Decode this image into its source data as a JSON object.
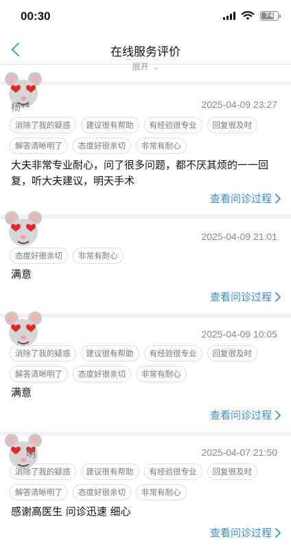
{
  "status_bar": {
    "time": "00:30",
    "battery": "74"
  },
  "nav": {
    "title": "在线服务评价",
    "expand_label": "展开"
  },
  "reviews": [
    {
      "username": "杨**",
      "date": "2025-04-09 23:27",
      "tags": [
        "消除了我的疑惑",
        "建议很有帮助",
        "有经验很专业",
        "回复很及时",
        "解答清晰明了",
        "态度好很亲切",
        "非常有耐心"
      ],
      "text": "大夫非常专业耐心，问了很多问题，都不厌其烦的一一回复，听大夫建议，明天手术",
      "link": "查看问诊过程"
    },
    {
      "username": "",
      "date": "2025-04-09 21:01",
      "tags": [
        "态度好很亲切",
        "非常有耐心"
      ],
      "text": "满意",
      "link": "查看问诊过程"
    },
    {
      "username": "",
      "date": "2025-04-09 10:05",
      "tags": [
        "消除了我的疑惑",
        "建议很有帮助",
        "有经验很专业",
        "回复很及时",
        "解答清晰明了",
        "态度好很亲切",
        "非常有耐心"
      ],
      "text": "满意",
      "link": "查看问诊过程"
    },
    {
      "username": "明",
      "date": "2025-04-07 21:50",
      "tags": [
        "消除了我的疑惑",
        "建议很有帮助",
        "有经验很专业",
        "回复很及时",
        "解答清晰明了",
        "态度好很亲切",
        "非常有耐心"
      ],
      "text": "感谢高医生 问诊迅速 细心",
      "link": "查看问诊过程"
    }
  ]
}
